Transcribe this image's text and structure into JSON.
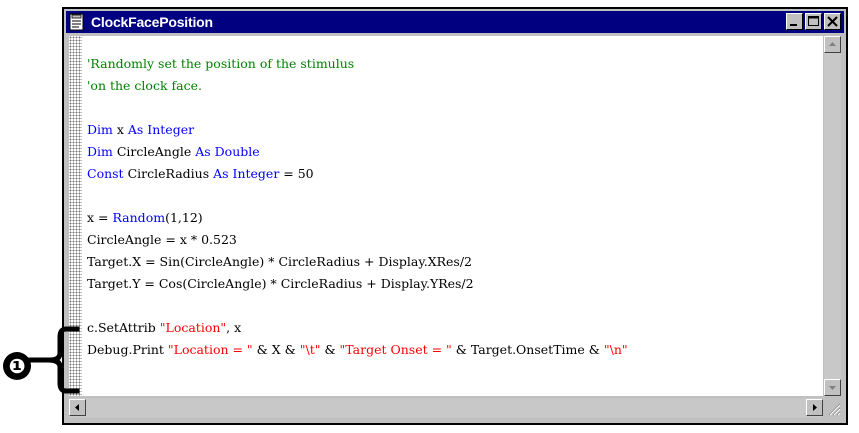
{
  "window": {
    "title": "ClockFacePosition",
    "controls": [
      "minimize",
      "maximize",
      "close"
    ]
  },
  "code_lines": [
    [
      {
        "t": "'Randomly set the position of the stimulus",
        "c": "cm"
      }
    ],
    [
      {
        "t": "'on the clock face.",
        "c": "cm"
      }
    ],
    [
      {
        "t": "",
        "c": ""
      }
    ],
    [
      {
        "t": "Dim",
        "c": "kw"
      },
      {
        "t": " x ",
        "c": ""
      },
      {
        "t": "As Integer",
        "c": "kw"
      }
    ],
    [
      {
        "t": "Dim",
        "c": "kw"
      },
      {
        "t": " CircleAngle ",
        "c": ""
      },
      {
        "t": "As Double",
        "c": "kw"
      }
    ],
    [
      {
        "t": "Const",
        "c": "kw"
      },
      {
        "t": " CircleRadius ",
        "c": ""
      },
      {
        "t": "As Integer",
        "c": "kw"
      },
      {
        "t": " = 50",
        "c": ""
      }
    ],
    [
      {
        "t": "",
        "c": ""
      }
    ],
    [
      {
        "t": "x = ",
        "c": ""
      },
      {
        "t": "Random",
        "c": "kw"
      },
      {
        "t": "(1,12)",
        "c": ""
      }
    ],
    [
      {
        "t": "CircleAngle = x * 0.523",
        "c": ""
      }
    ],
    [
      {
        "t": "Target.X = Sin(CircleAngle) * CircleRadius + Display.XRes/2",
        "c": ""
      }
    ],
    [
      {
        "t": "Target.Y = Cos(CircleAngle) * CircleRadius + Display.YRes/2",
        "c": ""
      }
    ],
    [
      {
        "t": "",
        "c": ""
      }
    ],
    [
      {
        "t": "c.SetAttrib ",
        "c": ""
      },
      {
        "t": "\"Location\"",
        "c": "st"
      },
      {
        "t": ", x",
        "c": ""
      }
    ],
    [
      {
        "t": "Debug.Print ",
        "c": ""
      },
      {
        "t": "\"Location = \"",
        "c": "st"
      },
      {
        "t": " & X & ",
        "c": ""
      },
      {
        "t": "\"\\t\"",
        "c": "st"
      },
      {
        "t": " & ",
        "c": ""
      },
      {
        "t": "\"Target Onset = \"",
        "c": "st"
      },
      {
        "t": " & Target.OnsetTime & ",
        "c": ""
      },
      {
        "t": "\"\\n\"",
        "c": "st"
      }
    ]
  ],
  "callout": {
    "number": "❶"
  },
  "colors": {
    "titlebar": "#000080",
    "comment": "#008000",
    "keyword": "#0000ff",
    "string": "#ff0000"
  }
}
